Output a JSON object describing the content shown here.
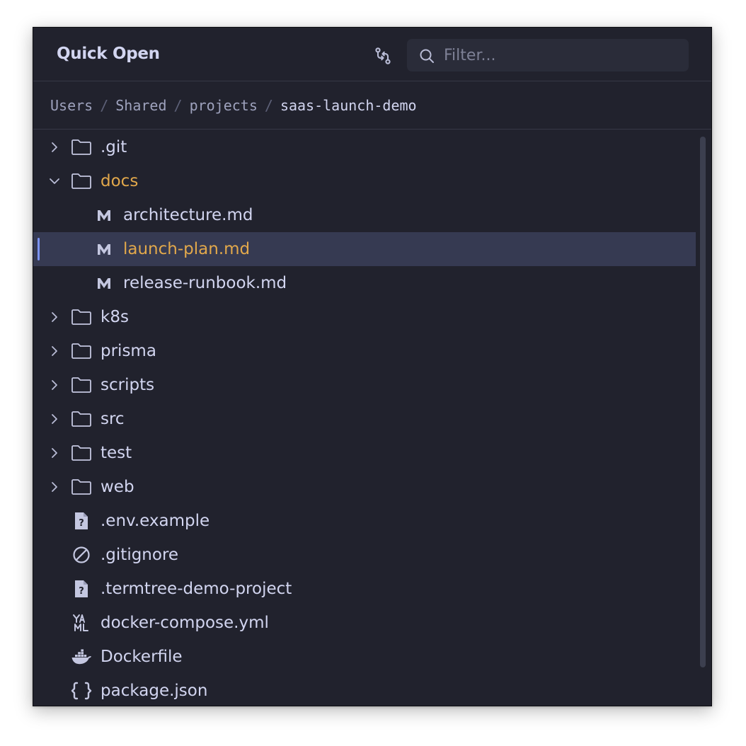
{
  "header": {
    "title": "Quick Open",
    "filter_placeholder": "Filter...",
    "filter_value": ""
  },
  "breadcrumb": {
    "segments": [
      "Users",
      "Shared",
      "projects",
      "saas-launch-demo"
    ],
    "separator": "/"
  },
  "tree": {
    "items": [
      {
        "label": ".git",
        "type": "folder",
        "expanded": false
      },
      {
        "label": "docs",
        "type": "folder",
        "expanded": true
      },
      {
        "label": "architecture.md",
        "type": "markdown-file"
      },
      {
        "label": "launch-plan.md",
        "type": "markdown-file",
        "selected": true
      },
      {
        "label": "release-runbook.md",
        "type": "markdown-file"
      },
      {
        "label": "k8s",
        "type": "folder",
        "expanded": false
      },
      {
        "label": "prisma",
        "type": "folder",
        "expanded": false
      },
      {
        "label": "scripts",
        "type": "folder",
        "expanded": false
      },
      {
        "label": "src",
        "type": "folder",
        "expanded": false
      },
      {
        "label": "test",
        "type": "folder",
        "expanded": false
      },
      {
        "label": "web",
        "type": "folder",
        "expanded": false
      },
      {
        "label": ".env.example",
        "type": "unknown-file"
      },
      {
        "label": ".gitignore",
        "type": "ignore-file"
      },
      {
        "label": ".termtree-demo-project",
        "type": "unknown-file"
      },
      {
        "label": "docker-compose.yml",
        "type": "yaml-file"
      },
      {
        "label": "Dockerfile",
        "type": "docker-file"
      },
      {
        "label": "package.json",
        "type": "json-file"
      }
    ]
  },
  "colors": {
    "background": "#21222d",
    "text": "#d2d5f0",
    "accent": "#e2a84b",
    "selection": "#363a52",
    "selection_bar": "#7b93f5"
  }
}
